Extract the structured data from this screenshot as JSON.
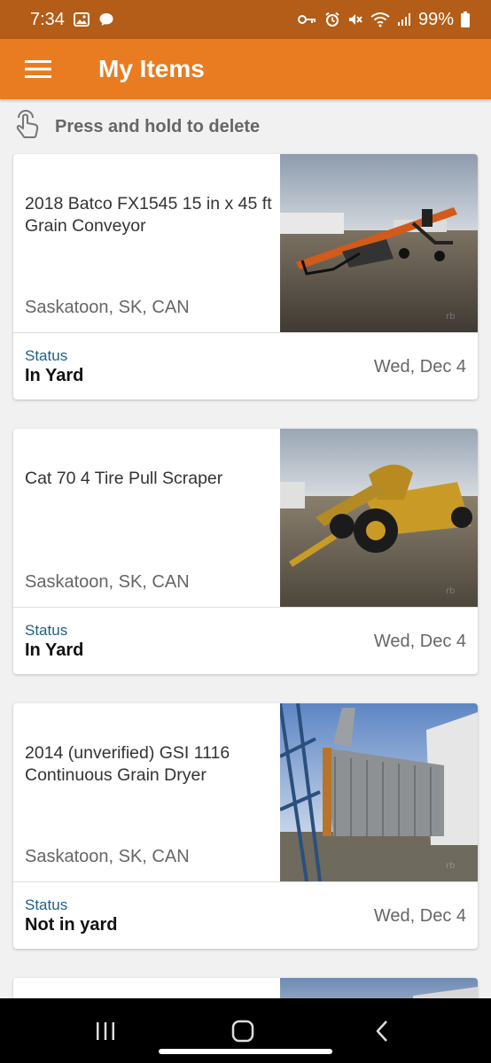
{
  "status_bar": {
    "time": "7:34",
    "battery": "99%",
    "left_icons": [
      "gallery-icon",
      "chat-icon"
    ],
    "right_icons": [
      "key-icon",
      "alarm-icon",
      "mute-icon",
      "wifi-icon",
      "signal-icon",
      "battery-icon"
    ]
  },
  "app_bar": {
    "title": "My Items",
    "menu_icon": "hamburger-menu-icon",
    "background_color": "#e97c20"
  },
  "hint": {
    "text": "Press and hold to delete",
    "icon": "touch-hand-icon"
  },
  "items": [
    {
      "title": "2018 Batco FX1545 15 in x 45 ft Grain Conveyor",
      "location": "Saskatoon, SK, CAN",
      "status_label": "Status",
      "status": "In Yard",
      "date": "Wed, Dec 4"
    },
    {
      "title": "Cat 70 4 Tire Pull Scraper",
      "location": "Saskatoon, SK, CAN",
      "status_label": "Status",
      "status": "In Yard",
      "date": "Wed, Dec 4"
    },
    {
      "title": "2014 (unverified) GSI 1116 Continuous Grain Dryer",
      "location": "Saskatoon, SK, CAN",
      "status_label": "Status",
      "status": "Not in yard",
      "date": "Wed, Dec 4"
    }
  ],
  "nav_bar": {
    "icons": [
      "recent-apps-icon",
      "home-icon",
      "back-icon"
    ]
  },
  "colors": {
    "status_bar": "#b35d18",
    "accent": "#e97c20",
    "status_label": "#1d5f86"
  }
}
